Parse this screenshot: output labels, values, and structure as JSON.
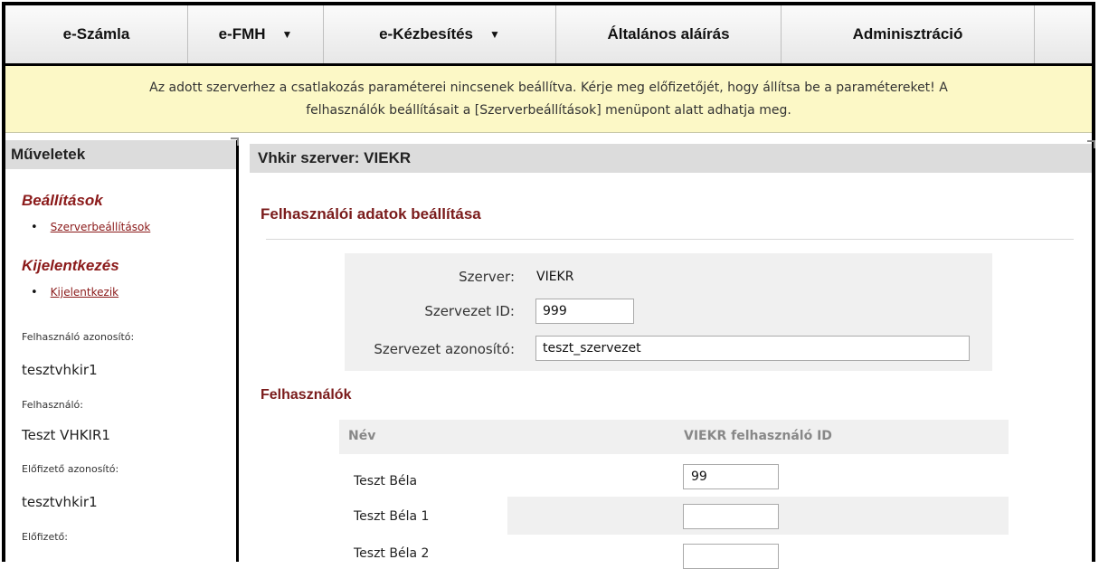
{
  "menu": {
    "items": [
      {
        "label": "e-Számla",
        "has_dropdown": false
      },
      {
        "label": "e-FMH",
        "has_dropdown": true
      },
      {
        "label": "e-Kézbesítés",
        "has_dropdown": true
      },
      {
        "label": "Általános aláírás",
        "has_dropdown": false
      },
      {
        "label": "Adminisztráció",
        "has_dropdown": false
      },
      {
        "label": "",
        "has_dropdown": false
      }
    ],
    "caret": "▼"
  },
  "notice": {
    "line1": "Az adott szerverhez a csatlakozás paraméterei nincsenek beállítva. Kérje meg előfizetőjét, hogy állítsa be a paramétereket! A",
    "line2": "felhasználók beállításait a [Szerverbeállítások] menüpont alatt adhatja meg."
  },
  "sidebar": {
    "title": "Műveletek",
    "sections": [
      {
        "title": "Beállítások",
        "link": "Szerverbeállítások"
      },
      {
        "title": "Kijelentkezés",
        "link": "Kijelentkezik"
      }
    ],
    "info": [
      {
        "label": "Felhasználó azonosító:",
        "value": "tesztvhkir1"
      },
      {
        "label": "Felhasználó:",
        "value": "Teszt VHKIR1"
      },
      {
        "label": "Előfizető azonosító:",
        "value": "tesztvhkir1"
      },
      {
        "label": "Előfizető:",
        "value": ""
      }
    ]
  },
  "main": {
    "header": "Vhkir szerver: VIEKR",
    "section_title": "Felhasználói adatok beállítása",
    "form": {
      "server_label": "Szerver:",
      "server_value": "VIEKR",
      "org_id_label": "Szervezet ID:",
      "org_id_value": "999",
      "org_code_label": "Szervezet azonosító:",
      "org_code_value": "teszt_szervezet"
    },
    "users": {
      "title": "Felhasználók",
      "col_name": "Név",
      "col_id": "VIEKR felhasználó ID",
      "rows": [
        {
          "name": "Teszt Béla",
          "id": "99"
        },
        {
          "name": "Teszt Béla 1",
          "id": ""
        },
        {
          "name": "Teszt Béla 2",
          "id": ""
        }
      ]
    }
  },
  "colors": {
    "accent": "#8b1a1a",
    "notice_bg": "#fcf8c6",
    "header_bg": "#dcdcdc"
  }
}
